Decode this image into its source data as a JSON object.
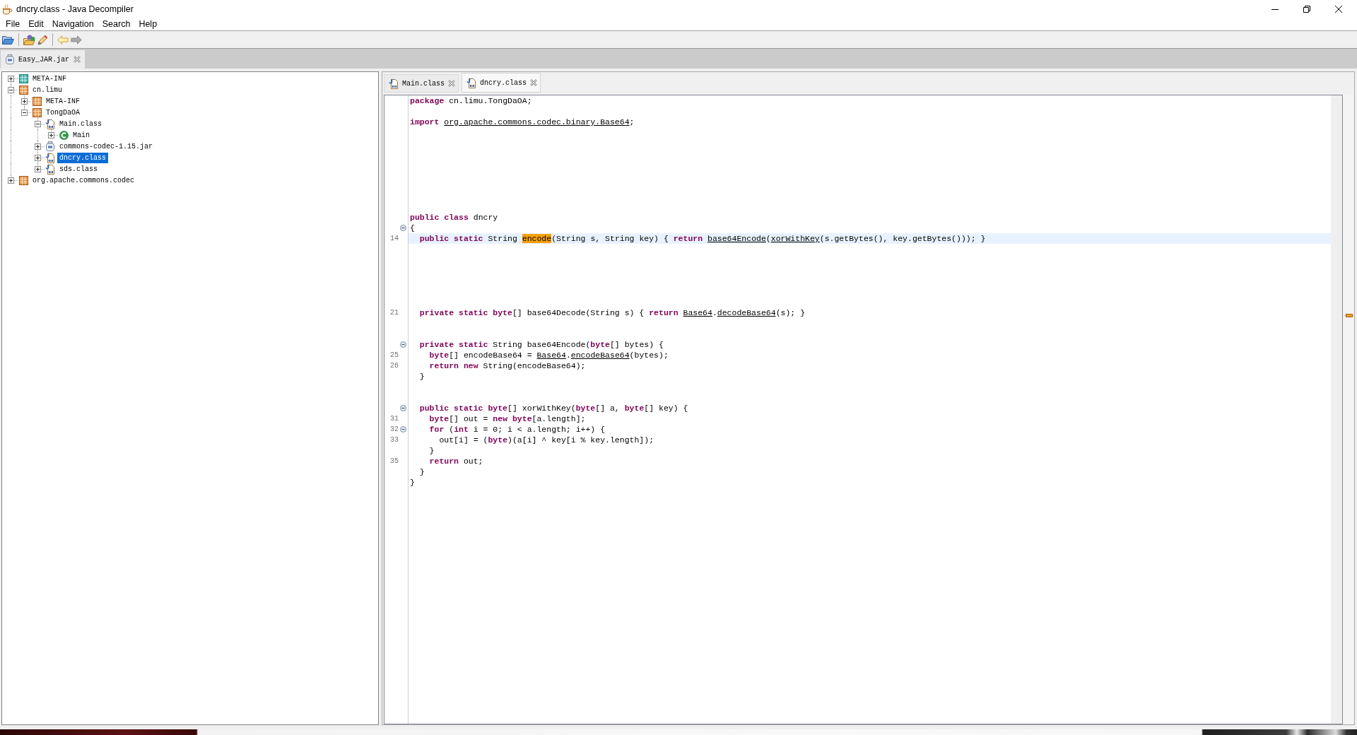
{
  "window": {
    "title": "dncry.class - Java Decompiler"
  },
  "menu": [
    "File",
    "Edit",
    "Navigation",
    "Search",
    "Help"
  ],
  "toolbar": {
    "groups": [
      [
        {
          "kind": "open",
          "disabled": false
        }
      ],
      [
        {
          "kind": "open-type",
          "disabled": false
        },
        {
          "kind": "search",
          "disabled": false
        }
      ],
      [
        {
          "kind": "back",
          "disabled": false
        },
        {
          "kind": "forward",
          "disabled": true
        }
      ]
    ]
  },
  "file_tabs": [
    {
      "label": "Easy_JAR.jar",
      "selected": true
    }
  ],
  "tree": {
    "items": [
      {
        "label": "META-INF",
        "kind": "directory",
        "expanded": false,
        "selected": false
      },
      {
        "label": "cn.limu",
        "kind": "package",
        "expanded": true,
        "selected": false,
        "children": [
          {
            "label": "META-INF",
            "kind": "package",
            "expanded": false,
            "selected": false
          },
          {
            "label": "TongDaOA",
            "kind": "package",
            "expanded": true,
            "selected": false,
            "children": [
              {
                "label": "Main.class",
                "kind": "class-file",
                "expanded": true,
                "selected": false,
                "children": [
                  {
                    "label": "Main",
                    "kind": "class",
                    "expanded": false,
                    "selected": false
                  }
                ]
              },
              {
                "label": "commons-codec-1.15.jar",
                "kind": "jar",
                "expanded": false,
                "selected": false
              },
              {
                "label": "dncry.class",
                "kind": "class-file",
                "expanded": false,
                "selected": true
              },
              {
                "label": "sds.class",
                "kind": "class-file",
                "expanded": false,
                "selected": false
              }
            ]
          }
        ]
      },
      {
        "label": "org.apache.commons.codec",
        "kind": "package",
        "expanded": false,
        "selected": false
      }
    ]
  },
  "editor": {
    "tabs": [
      {
        "label": "Main.class",
        "selected": false
      },
      {
        "label": "dncry.class",
        "selected": true
      }
    ],
    "lines": [
      {
        "fold": false,
        "current": false,
        "segments": [
          {
            "kind": "keyword",
            "text": "package"
          },
          {
            "kind": "plain",
            "text": " cn.limu.TongDaOA;"
          }
        ]
      },
      {
        "fold": false,
        "current": false
      },
      {
        "fold": false,
        "current": false,
        "segments": [
          {
            "kind": "keyword",
            "text": "import "
          },
          {
            "kind": "link",
            "text": "org.apache.commons.codec.binary.Base64"
          },
          {
            "kind": "plain",
            "text": ";"
          }
        ]
      },
      {
        "fold": false,
        "current": false
      },
      {
        "fold": false,
        "current": false
      },
      {
        "fold": false,
        "current": false
      },
      {
        "fold": false,
        "current": false
      },
      {
        "fold": false,
        "current": false
      },
      {
        "fold": false,
        "current": false
      },
      {
        "fold": false,
        "current": false
      },
      {
        "fold": false,
        "current": false
      },
      {
        "fold": false,
        "current": false,
        "segments": [
          {
            "kind": "keyword",
            "text": "public class"
          },
          {
            "kind": "plain",
            "text": " dncry"
          }
        ]
      },
      {
        "fold": true,
        "current": false,
        "segments": [
          {
            "kind": "plain",
            "text": "{"
          }
        ]
      },
      {
        "number": "14",
        "fold": false,
        "current": true,
        "segments": [
          {
            "kind": "keyword",
            "text": "  public static"
          },
          {
            "kind": "plain",
            "text": " String "
          },
          {
            "kind": "match",
            "text": "encode"
          },
          {
            "kind": "plain",
            "text": "(String s, String key) { "
          },
          {
            "kind": "keyword",
            "text": "return "
          },
          {
            "kind": "link",
            "text": "base64Encode"
          },
          {
            "kind": "plain",
            "text": "("
          },
          {
            "kind": "link",
            "text": "xorWithKey"
          },
          {
            "kind": "plain",
            "text": "(s.getBytes(), key.getBytes())); }"
          }
        ]
      },
      {
        "fold": false,
        "current": false
      },
      {
        "fold": false,
        "current": false
      },
      {
        "fold": false,
        "current": false
      },
      {
        "fold": false,
        "current": false
      },
      {
        "fold": false,
        "current": false
      },
      {
        "fold": false,
        "current": false
      },
      {
        "number": "21",
        "fold": false,
        "current": false,
        "segments": [
          {
            "kind": "keyword",
            "text": "  private static byte"
          },
          {
            "kind": "plain",
            "text": "[] base64Decode(String s) { "
          },
          {
            "kind": "keyword",
            "text": "return "
          },
          {
            "kind": "link",
            "text": "Base64"
          },
          {
            "kind": "plain",
            "text": "."
          },
          {
            "kind": "link",
            "text": "decodeBase64"
          },
          {
            "kind": "plain",
            "text": "(s); }"
          }
        ]
      },
      {
        "fold": false,
        "current": false
      },
      {
        "fold": false,
        "current": false
      },
      {
        "fold": true,
        "current": false,
        "segments": [
          {
            "kind": "keyword",
            "text": "  private static"
          },
          {
            "kind": "plain",
            "text": " String base64Encode("
          },
          {
            "kind": "keyword",
            "text": "byte"
          },
          {
            "kind": "plain",
            "text": "[] bytes) {"
          }
        ]
      },
      {
        "number": "25",
        "fold": false,
        "current": false,
        "segments": [
          {
            "kind": "keyword",
            "text": "    byte"
          },
          {
            "kind": "plain",
            "text": "[] encodeBase64 = "
          },
          {
            "kind": "link",
            "text": "Base64"
          },
          {
            "kind": "plain",
            "text": "."
          },
          {
            "kind": "link",
            "text": "encodeBase64"
          },
          {
            "kind": "plain",
            "text": "(bytes);"
          }
        ]
      },
      {
        "number": "26",
        "fold": false,
        "current": false,
        "segments": [
          {
            "kind": "keyword",
            "text": "    return new"
          },
          {
            "kind": "plain",
            "text": " String(encodeBase64);"
          }
        ]
      },
      {
        "fold": false,
        "current": false,
        "segments": [
          {
            "kind": "plain",
            "text": "  }"
          }
        ]
      },
      {
        "fold": false,
        "current": false
      },
      {
        "fold": false,
        "current": false
      },
      {
        "fold": true,
        "current": false,
        "segments": [
          {
            "kind": "keyword",
            "text": "  public static byte"
          },
          {
            "kind": "plain",
            "text": "[] xorWithKey("
          },
          {
            "kind": "keyword",
            "text": "byte"
          },
          {
            "kind": "plain",
            "text": "[] a, "
          },
          {
            "kind": "keyword",
            "text": "byte"
          },
          {
            "kind": "plain",
            "text": "[] key) {"
          }
        ]
      },
      {
        "number": "31",
        "fold": false,
        "current": false,
        "segments": [
          {
            "kind": "keyword",
            "text": "    byte"
          },
          {
            "kind": "plain",
            "text": "[] out = "
          },
          {
            "kind": "keyword",
            "text": "new byte"
          },
          {
            "kind": "plain",
            "text": "[a.length];"
          }
        ]
      },
      {
        "number": "32",
        "fold": true,
        "current": false,
        "segments": [
          {
            "kind": "keyword",
            "text": "    for"
          },
          {
            "kind": "plain",
            "text": " ("
          },
          {
            "kind": "keyword",
            "text": "int"
          },
          {
            "kind": "plain",
            "text": " i = 0; i < a.length; i++) {"
          }
        ]
      },
      {
        "number": "33",
        "fold": false,
        "current": false,
        "segments": [
          {
            "kind": "plain",
            "text": "      out[i] = ("
          },
          {
            "kind": "keyword",
            "text": "byte"
          },
          {
            "kind": "plain",
            "text": ")(a[i] ^ key[i % key.length]);"
          }
        ]
      },
      {
        "fold": false,
        "current": false,
        "segments": [
          {
            "kind": "plain",
            "text": "    }"
          }
        ]
      },
      {
        "number": "35",
        "fold": false,
        "current": false,
        "segments": [
          {
            "kind": "keyword",
            "text": "    return"
          },
          {
            "kind": "plain",
            "text": " out;"
          }
        ]
      },
      {
        "fold": false,
        "current": false,
        "segments": [
          {
            "kind": "plain",
            "text": "  }"
          }
        ]
      },
      {
        "fold": false,
        "current": false,
        "segments": [
          {
            "kind": "plain",
            "text": "}"
          }
        ]
      }
    ]
  }
}
